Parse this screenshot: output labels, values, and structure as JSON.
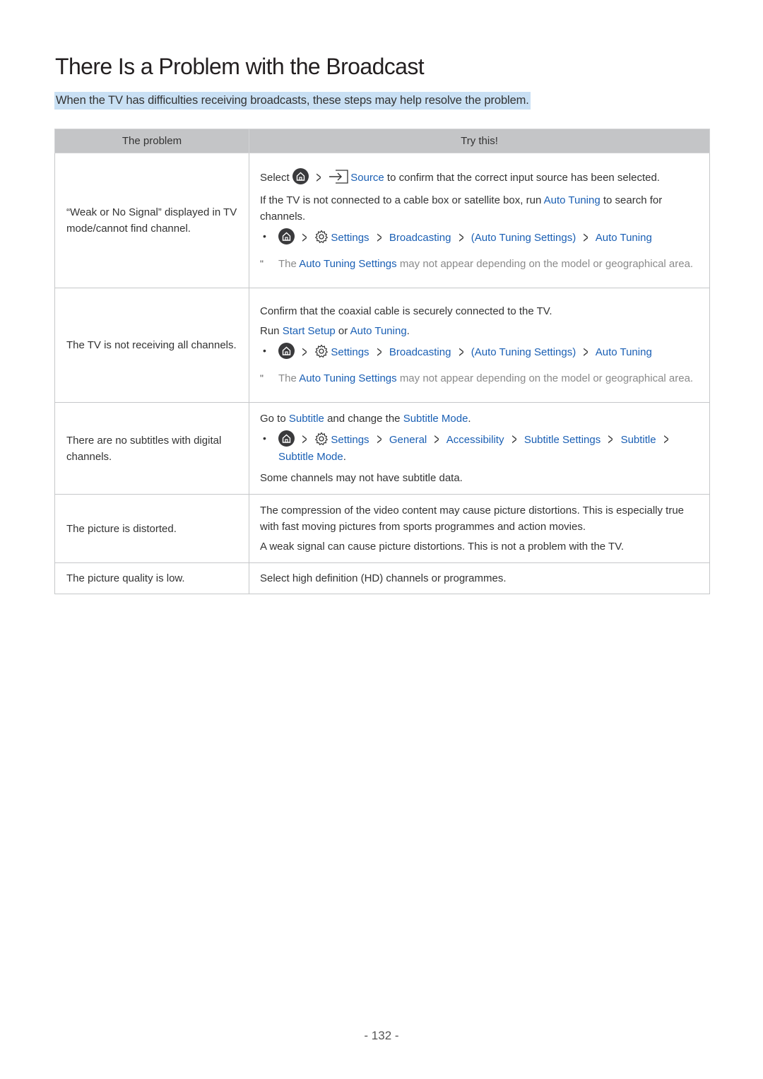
{
  "page": {
    "title": "There Is a Problem with the Broadcast",
    "lead": "When the TV has difficulties receiving broadcasts, these steps may help resolve the problem.",
    "page_number": "- 132 -"
  },
  "table": {
    "headers": [
      "The problem",
      "Try this!"
    ],
    "rows": [
      {
        "problem": "“Weak or No Signal” displayed in TV mode/cannot find channel.",
        "select_prefix": "Select",
        "source_label": "Source",
        "source_suffix": "to confirm that the correct input source has been selected.",
        "line2_prefix": "If the TV is not connected to a cable box or satellite box, run",
        "line2_link": "Auto Tuning",
        "line2_suffix": "to search for channels.",
        "path": [
          "Settings",
          "Broadcasting",
          "(Auto Tuning Settings)",
          "Auto Tuning"
        ],
        "note_prefix": "The",
        "note_link": "Auto Tuning Settings",
        "note_suffix": "may not appear depending on the model or geographical area.",
        "note_mark": "\""
      },
      {
        "problem": "The TV is not receiving all channels.",
        "line1": "Confirm that the coaxial cable is securely connected to the TV.",
        "line2_prefix": "Run",
        "line2_link1": "Start Setup",
        "line2_mid": "or",
        "line2_link2": "Auto Tuning",
        "line2_end": ".",
        "path": [
          "Settings",
          "Broadcasting",
          "(Auto Tuning Settings)",
          "Auto Tuning"
        ],
        "note_prefix": "The",
        "note_link": "Auto Tuning Settings",
        "note_suffix": "may not appear depending on the model or geographical area.",
        "note_mark": "\""
      },
      {
        "problem": "There are no subtitles with digital channels.",
        "line1_prefix": "Go to",
        "line1_link1": "Subtitle",
        "line1_mid": "and change the",
        "line1_link2": "Subtitle Mode",
        "line1_end": ".",
        "path": [
          "Settings",
          "General",
          "Accessibility",
          "Subtitle Settings",
          "Subtitle",
          "Subtitle Mode"
        ],
        "path_end": ".",
        "line3": "Some channels may not have subtitle data."
      },
      {
        "problem": "The picture is distorted.",
        "line1": "The compression of the video content may cause picture distortions. This is especially true with fast moving pictures from sports programmes and action movies.",
        "line2": "A weak signal can cause picture distortions. This is not a problem with the TV."
      },
      {
        "problem": "The picture quality is low.",
        "line1": "Select high definition (HD) channels or programmes."
      }
    ]
  },
  "icons": {
    "home": "home-icon",
    "settings": "gear-icon",
    "source": "source-input-icon",
    "chevron": "chevron-right-icon",
    "bullet": "•"
  },
  "colors": {
    "link": "#1a5fb4",
    "header_bg": "#c4c5c7",
    "lead_highlight": "#c9e0f4",
    "note_text": "#8a8a8a"
  }
}
